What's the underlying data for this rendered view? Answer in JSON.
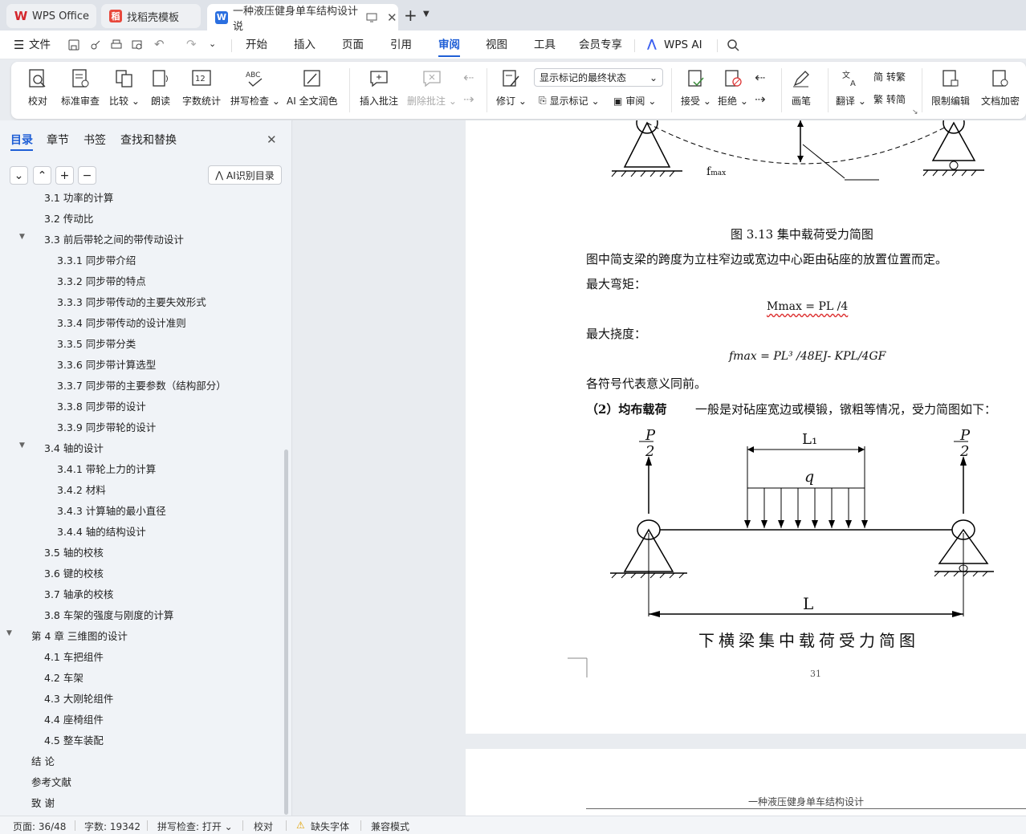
{
  "tabs": {
    "wps": "WPS Office",
    "template": "找稻壳模板",
    "doc": "一种液压健身单车结构设计 说"
  },
  "menu": {
    "file": "文件",
    "items": [
      "开始",
      "插入",
      "页面",
      "引用",
      "审阅",
      "视图",
      "工具",
      "会员专享",
      "WPS AI"
    ],
    "active": "审阅"
  },
  "ribbon": {
    "proofread": "校对",
    "std_review": "标准审查",
    "compare": "比较",
    "read_aloud": "朗读",
    "word_count": "字数统计",
    "spell_check": "拼写检查",
    "ai_polish": "AI 全文润色",
    "insert_comment": "插入批注",
    "delete_comment": "删除批注",
    "revise": "修订",
    "markup_select": "显示标记的最终状态",
    "show_markup": "显示标记",
    "review": "审阅",
    "accept": "接受",
    "reject": "拒绝",
    "pen": "画笔",
    "translate": "翻译",
    "to_trad": "转繁",
    "to_simp": "转简",
    "restrict": "限制编辑",
    "encrypt": "文档加密"
  },
  "sidebar": {
    "tabs": [
      "目录",
      "章节",
      "书签",
      "查找和替换"
    ],
    "ai_toc": "AI识别目录",
    "toc": [
      {
        "text": "3.1 功率的计算",
        "level": 2
      },
      {
        "text": "3.2  传动比",
        "level": 2
      },
      {
        "text": "3.3  前后带轮之间的带传动设计",
        "level": 2,
        "expand": true
      },
      {
        "text": "3.3.1    同步带介绍",
        "level": 3
      },
      {
        "text": "3.3.2    同步带的特点",
        "level": 3
      },
      {
        "text": "3.3.3    同步带传动的主要失效形式",
        "level": 3
      },
      {
        "text": "3.3.4    同步带传动的设计准则",
        "level": 3
      },
      {
        "text": "3.3.5    同步带分类",
        "level": 3
      },
      {
        "text": "3.3.6    同步带计算选型",
        "level": 3
      },
      {
        "text": "3.3.7    同步带的主要参数（结构部分）",
        "level": 3
      },
      {
        "text": "3.3.8    同步带的设计",
        "level": 3
      },
      {
        "text": "3.3.9    同步带轮的设计",
        "level": 3
      },
      {
        "text": "3.4  轴的设计",
        "level": 2,
        "expand": true
      },
      {
        "text": "3.4.1 带轮上力的计算",
        "level": 3
      },
      {
        "text": "3.4.2 材料",
        "level": 3
      },
      {
        "text": "3.4.3 计算轴的最小直径",
        "level": 3
      },
      {
        "text": "3.4.4 轴的结构设计",
        "level": 3
      },
      {
        "text": "3.5 轴的校核",
        "level": 2
      },
      {
        "text": "3.6 键的校核",
        "level": 2
      },
      {
        "text": "3.7  轴承的校核",
        "level": 2
      },
      {
        "text": "3.8  车架的强度与刚度的计算",
        "level": 2
      },
      {
        "text": "第 4 章  三维图的设计",
        "level": 1,
        "expand": true
      },
      {
        "text": "4.1  车把组件",
        "level": 2
      },
      {
        "text": "4.2  车架",
        "level": 2
      },
      {
        "text": "4.3  大刚轮组件",
        "level": 2
      },
      {
        "text": "4.4  座椅组件",
        "level": 2
      },
      {
        "text": "4.5  整车装配",
        "level": 2
      },
      {
        "text": "结  论",
        "level": 1
      },
      {
        "text": "参考文献",
        "level": 1
      },
      {
        "text": "致  谢",
        "level": 1
      }
    ]
  },
  "document": {
    "fmax_label": "f",
    "fmax_sub": "max",
    "fig_caption": "图 3.13  集中载荷受力简图",
    "para1": "图中简支梁的跨度为立柱窄边或宽边中心距由砧座的放置位置而定。",
    "max_moment_label": "最大弯矩：",
    "formula1": "Mmax  =  PL /4",
    "max_deflection_label": "最大挠度：",
    "formula2": "fmax  =  PL³ /48EJ- KPL/4GF",
    "para2": "各符号代表意义同前。",
    "uniform_title": "（2）均布载荷",
    "uniform_text": "一般是对砧座宽边或模锻，镦粗等情况，受力简图如下：",
    "p_num": "P",
    "p_den": "2",
    "l1_label": "L₁",
    "q_label": "q",
    "l_label": "L",
    "fig2_caption": "下横梁集中载荷受力简图",
    "page_number": "31",
    "next_header": "一种液压健身单车结构设计"
  },
  "status": {
    "page": "页面: 36/48",
    "words": "字数: 19342",
    "spell": "拼写检查: 打开",
    "proof": "校对",
    "missing_font": "缺失字体",
    "compat": "兼容模式"
  }
}
